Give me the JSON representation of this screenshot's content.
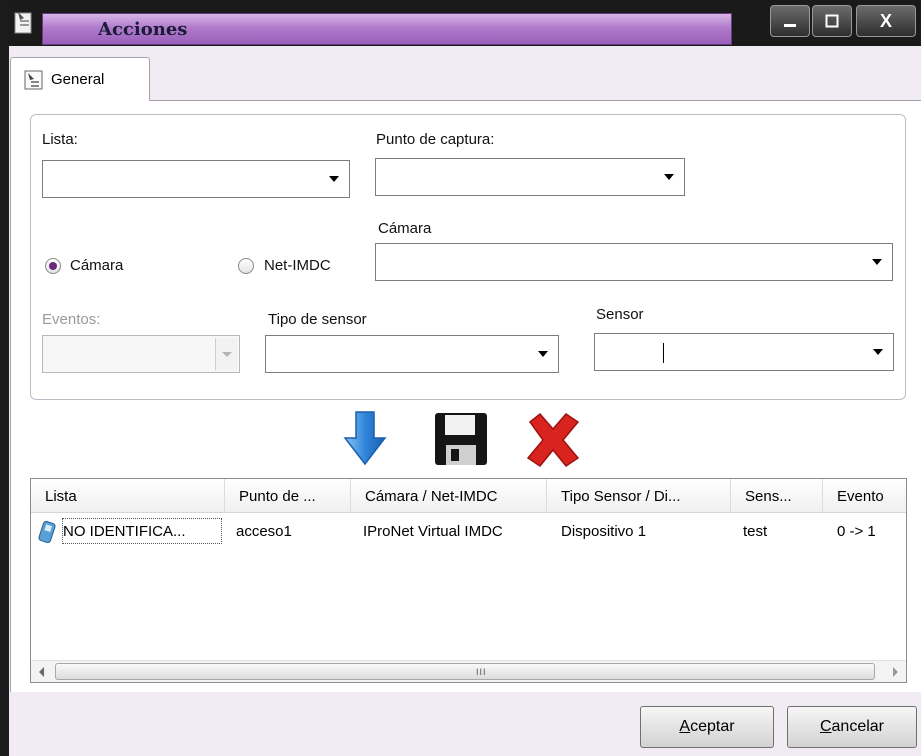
{
  "window": {
    "title": "Acciones",
    "controls": {
      "close_label": "X"
    }
  },
  "tabs": [
    {
      "label": "General",
      "icon": "general-tab-icon",
      "selected": true
    }
  ],
  "form": {
    "lista": {
      "label": "Lista:",
      "value": ""
    },
    "punto_captura": {
      "label": "Punto de captura:",
      "value": ""
    },
    "source": {
      "options": [
        {
          "label": "Cámara",
          "checked": true
        },
        {
          "label": "Net-IMDC",
          "checked": false
        }
      ]
    },
    "camara": {
      "label": "Cámara",
      "value": ""
    },
    "eventos": {
      "label": "Eventos:",
      "value": "",
      "disabled": true
    },
    "tipo_sensor": {
      "label": "Tipo de sensor",
      "value": ""
    },
    "sensor": {
      "label": "Sensor",
      "value": ""
    }
  },
  "toolbar": {
    "add_icon": "arrow-down-icon",
    "save_icon": "floppy-disk-icon",
    "delete_icon": "red-x-icon"
  },
  "list": {
    "columns": [
      "Lista",
      "Punto de ...",
      "Cámara / Net-IMDC",
      "Tipo Sensor / Di...",
      "Sens...",
      "Evento"
    ],
    "rows": [
      {
        "icon": "phone-icon",
        "cells": [
          "NO IDENTIFICA...",
          "acceso1",
          "IProNet Virtual IMDC",
          "Dispositivo 1",
          "test",
          "0 -> 1"
        ]
      }
    ],
    "scroll_grip": "III"
  },
  "buttons": {
    "ok": {
      "accel": "A",
      "rest": "ceptar"
    },
    "cancel": {
      "accel": "C",
      "rest": "ancelar"
    }
  },
  "colors": {
    "title_accent": "#b17ccb",
    "radio_checked": "#6a2a7c",
    "arrow_blue": "#2f86d9",
    "delete_red": "#d8231f"
  }
}
